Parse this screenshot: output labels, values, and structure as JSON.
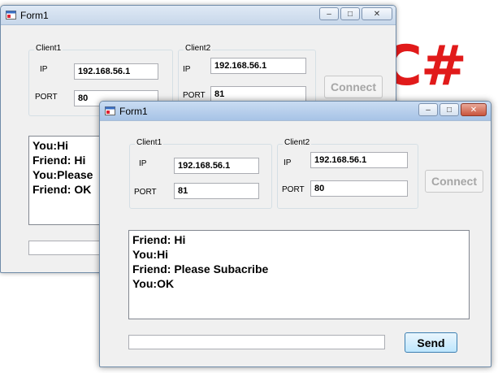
{
  "logo": {
    "text": "C#",
    "color": "#e11a1a"
  },
  "back_window": {
    "title": "Form1",
    "controls": {
      "minimize": "–",
      "maximize": "□",
      "close": "✕"
    },
    "client1": {
      "group_label": "Client1",
      "ip_label": "IP",
      "ip_value": "192.168.56.1",
      "port_label": "PORT",
      "port_value": "80"
    },
    "client2": {
      "group_label": "Client2",
      "ip_label": "IP",
      "ip_value": "192.168.56.1",
      "port_label": "PORT",
      "port_value": "81"
    },
    "connect_label": "Connect",
    "chat_lines": [
      "You:Hi",
      "Friend: Hi",
      "You:Please",
      "Friend: OK"
    ],
    "message_value": ""
  },
  "front_window": {
    "title": "Form1",
    "controls": {
      "minimize": "–",
      "maximize": "□",
      "close": "✕"
    },
    "client1": {
      "group_label": "Client1",
      "ip_label": "IP",
      "ip_value": "192.168.56.1",
      "port_label": "PORT",
      "port_value": "81"
    },
    "client2": {
      "group_label": "Client2",
      "ip_label": "IP",
      "ip_value": "192.168.56.1",
      "port_label": "PORT",
      "port_value": "80"
    },
    "connect_label": "Connect",
    "chat_lines": [
      "Friend: Hi",
      "You:Hi",
      "Friend: Please Subacribe",
      "You:OK"
    ],
    "message_value": "",
    "send_label": "Send"
  }
}
